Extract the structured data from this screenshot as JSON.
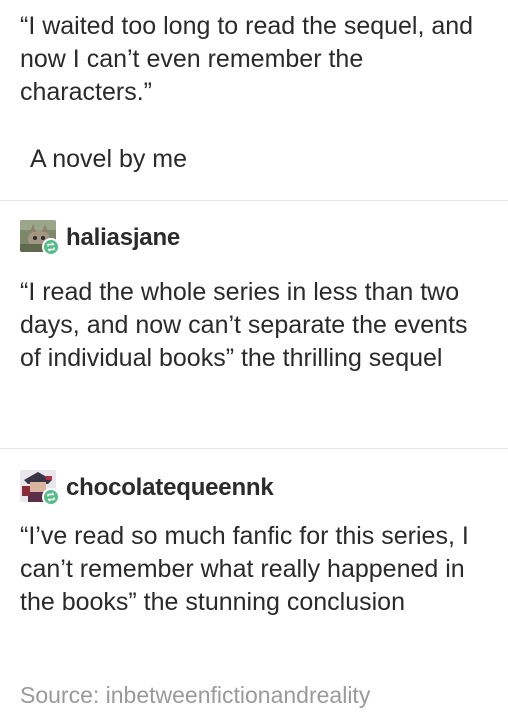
{
  "original_post": {
    "quote": "“I waited too long to read the sequel, and now I can’t even remember the characters.”",
    "caption": "A novel by me"
  },
  "reblogs": [
    {
      "username": "haliasjane",
      "avatar_icon": "cat-avatar-icon",
      "badge_icon": "reblog-icon",
      "badge_color": "#56bc8a",
      "text": "“I read the whole series in less than two days, and now can’t separate the events of individual books” the thrilling sequel"
    },
    {
      "username": "chocolatequeennk",
      "avatar_icon": "character-avatar-icon",
      "badge_icon": "reblog-icon",
      "badge_color": "#56bc8a",
      "text": "“I’ve read so much fanfic for this series, I can’t remember what really happened in the books” the stunning conclusion"
    }
  ],
  "source": {
    "text": "Source: inbetweenfictionandreality"
  }
}
